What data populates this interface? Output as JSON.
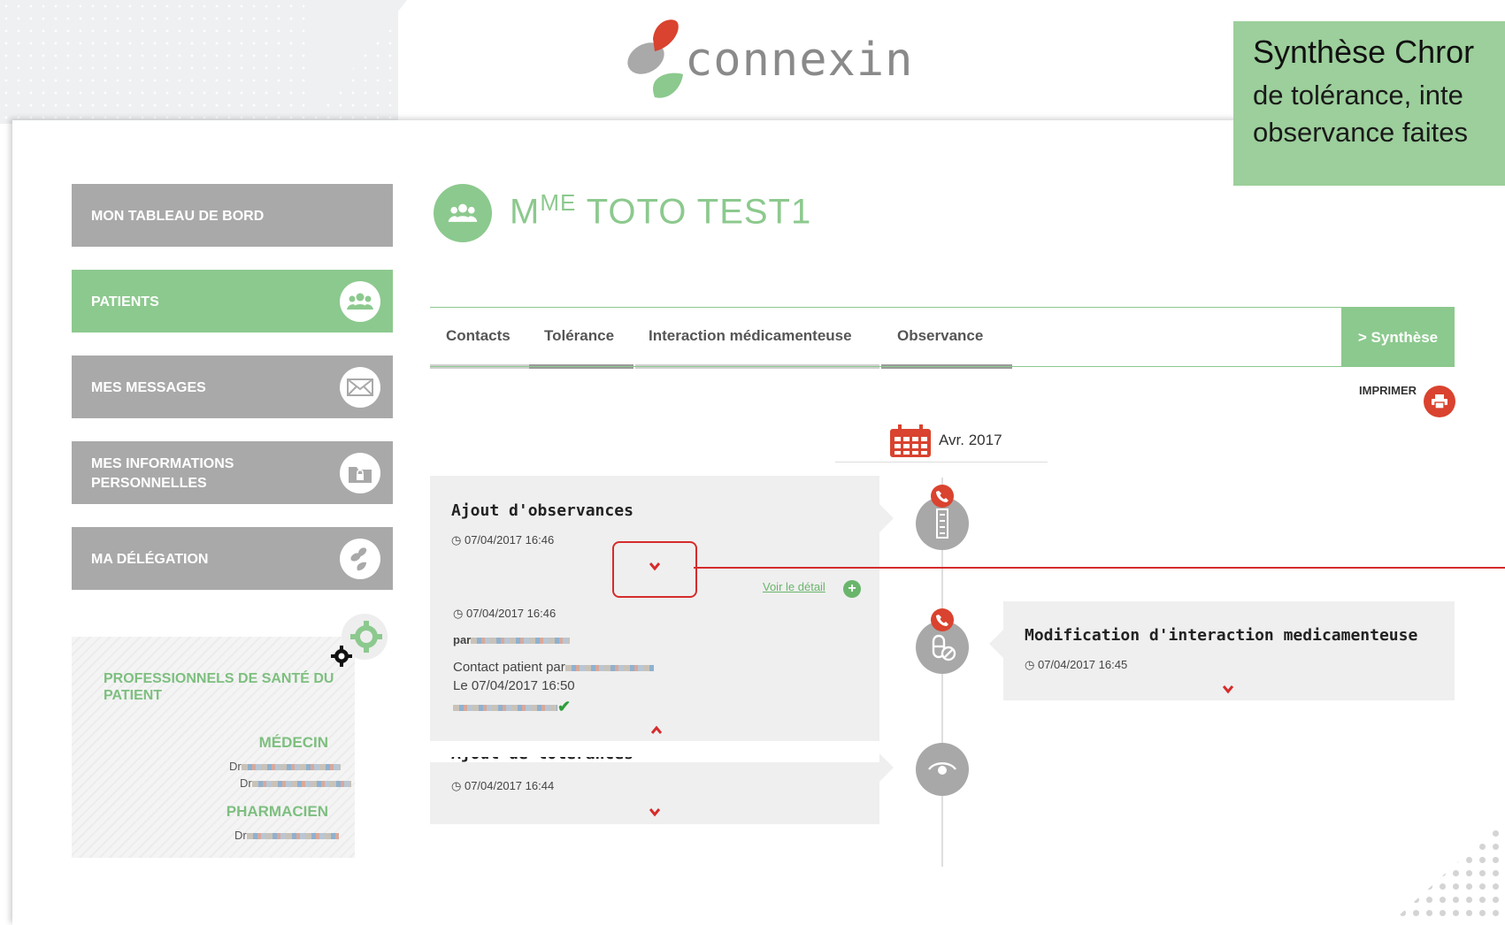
{
  "brand": {
    "name": "connexin"
  },
  "tooltip": {
    "title": "Synthèse Chror",
    "line1": "de tolérance, inte",
    "line2": "observance faites"
  },
  "sidebar": {
    "items": [
      {
        "label": "MON TABLEAU DE BORD",
        "icon": "",
        "active": false
      },
      {
        "label": "PATIENTS",
        "icon": "users-icon",
        "active": true
      },
      {
        "label": "MES MESSAGES",
        "icon": "envelope-icon",
        "active": false
      },
      {
        "label": "MES INFORMATIONS PERSONNELLES",
        "label_line1": "MES INFORMATIONS",
        "label_line2": "PERSONNELLES",
        "icon": "lock-folder-icon",
        "active": false
      },
      {
        "label": "MA DÉLÉGATION",
        "icon": "delegation-leaf-icon",
        "active": false
      }
    ]
  },
  "professionals": {
    "title": "PROFESSIONNELS DE SANTÉ DU PATIENT",
    "roles": [
      {
        "role": "MÉDECIN",
        "names": [
          "Dr",
          "Dr"
        ]
      },
      {
        "role": "PHARMACIEN",
        "names": [
          "Dr"
        ]
      }
    ]
  },
  "patient": {
    "title_prefix": "M",
    "title_sup": "ME",
    "name": "TOTO TEST1"
  },
  "tabs": [
    {
      "label": "Contacts"
    },
    {
      "label": "Tolérance"
    },
    {
      "label": "Interaction médicamenteuse"
    },
    {
      "label": "Observance"
    }
  ],
  "synthese_label": "> Synthèse",
  "print_label": "IMPRIMER",
  "timeline": {
    "month": "Avr. 2017",
    "events": [
      {
        "title": "Ajout d'observances",
        "date": "07/04/2017 16:46",
        "detail_link": "Voir le détail",
        "detail": {
          "date": "07/04/2017 16:46",
          "by_prefix": "par",
          "contact_prefix": "Contact patient par",
          "contact_date": "Le 07/04/2017 16:50"
        }
      },
      {
        "title": "Modification d'interaction medicamenteuse",
        "date": "07/04/2017 16:45"
      },
      {
        "title": "Ajout de tolérances",
        "date": "07/04/2017 16:44"
      }
    ]
  },
  "colors": {
    "accent_green": "#8cc98e",
    "nav_gray": "#a9a9a9",
    "alert_red": "#d9432f"
  }
}
